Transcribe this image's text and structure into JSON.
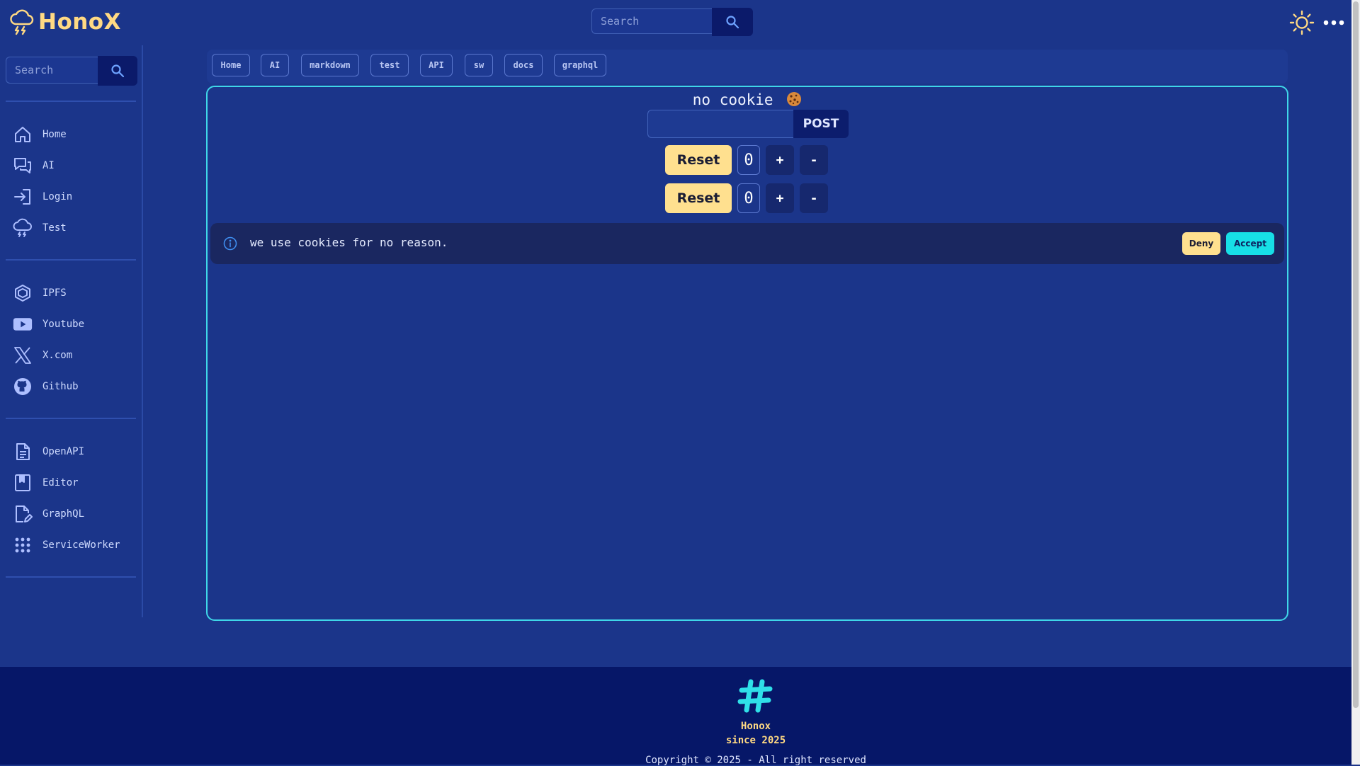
{
  "header": {
    "brand": "HonoX",
    "search_placeholder": "Search"
  },
  "sidebar": {
    "search_placeholder": "Search",
    "groups": [
      [
        {
          "label": "Home",
          "icon": "home-icon"
        },
        {
          "label": "AI",
          "icon": "chat-icon"
        },
        {
          "label": "Login",
          "icon": "login-icon"
        },
        {
          "label": "Test",
          "icon": "cloud-storm-icon"
        }
      ],
      [
        {
          "label": "IPFS",
          "icon": "cube-icon"
        },
        {
          "label": "Youtube",
          "icon": "youtube-icon"
        },
        {
          "label": "X.com",
          "icon": "x-logo-icon"
        },
        {
          "label": "Github",
          "icon": "github-icon"
        }
      ],
      [
        {
          "label": "OpenAPI",
          "icon": "document-icon"
        },
        {
          "label": "Editor",
          "icon": "book-icon"
        },
        {
          "label": "GraphQL",
          "icon": "file-edit-icon"
        },
        {
          "label": "ServiceWorker",
          "icon": "grid-icon"
        }
      ]
    ]
  },
  "tabs": [
    "Home",
    "AI",
    "markdown",
    "test",
    "API",
    "sw",
    "docs",
    "graphql"
  ],
  "main": {
    "cookie_status": "no cookie",
    "post_value": "",
    "post_label": "POST",
    "counters": [
      {
        "reset_label": "Reset",
        "value": "0",
        "plus": "+",
        "minus": "-"
      },
      {
        "reset_label": "Reset",
        "value": "0",
        "plus": "+",
        "minus": "-"
      }
    ],
    "banner": {
      "text": "we use cookies for no reason.",
      "deny_label": "Deny",
      "accept_label": "Accept"
    }
  },
  "footer": {
    "name": "Honox",
    "since": "since 2025",
    "copyright": "Copyright © 2025 - All right reserved"
  },
  "colors": {
    "background": "#1b358a",
    "brand": "#ffd983",
    "accent": "#3fd7e8",
    "button_yellow": "#ffe08f",
    "footer": "#061768"
  }
}
